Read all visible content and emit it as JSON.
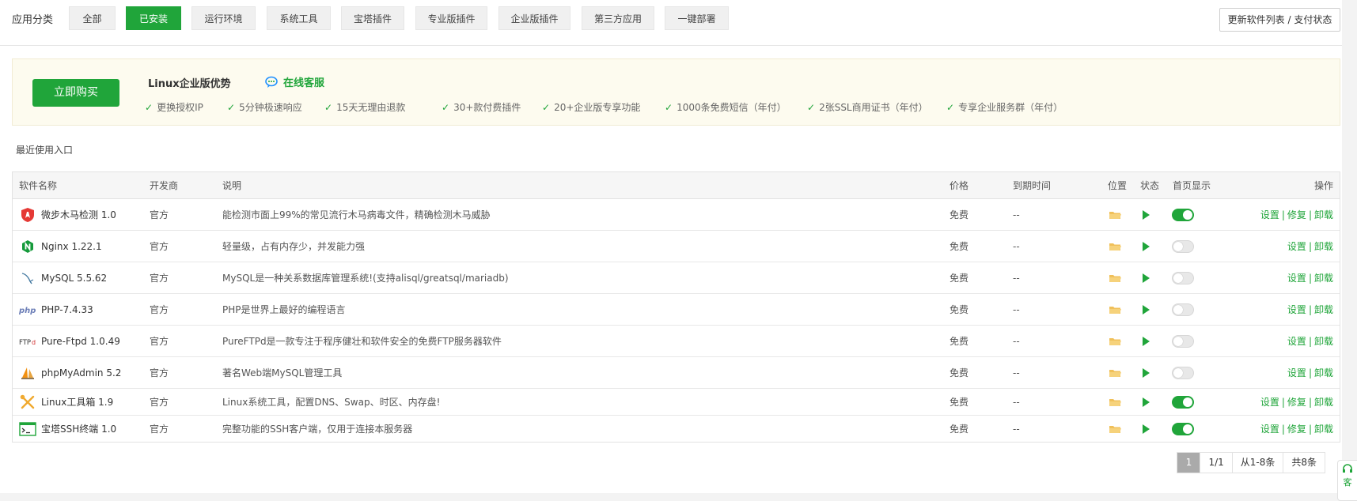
{
  "category": {
    "label": "应用分类",
    "tabs": [
      "全部",
      "已安装",
      "运行环境",
      "系统工具",
      "宝塔插件",
      "专业版插件",
      "企业版插件",
      "第三方应用",
      "一键部署"
    ],
    "active_index": 1,
    "update_button": "更新软件列表 / 支付状态"
  },
  "promo": {
    "buy_button": "立即购买",
    "title": "Linux企业版优势",
    "service_link": "在线客服",
    "features": [
      "更换授权IP",
      "5分钟极速响应",
      "15天无理由退款",
      "30+款付费插件",
      "20+企业版专享功能",
      "1000条免费短信（年付）",
      "2张SSL商用证书（年付）",
      "专享企业服务群（年付）"
    ]
  },
  "recent_label": "最近使用入口",
  "table": {
    "headers": {
      "name": "软件名称",
      "developer": "开发商",
      "description": "说明",
      "price": "价格",
      "expire": "到期时间",
      "location": "位置",
      "status": "状态",
      "homepage": "首页显示",
      "ops": "操作"
    },
    "rows": [
      {
        "icon": "shield-horse-icon",
        "name": "微步木马检测 1.0",
        "developer": "官方",
        "description": "能检测市面上99%的常见流行木马病毒文件，精确检测木马威胁",
        "price": "免费",
        "expire": "--",
        "homepage_on": true,
        "ops": [
          "设置",
          "修复",
          "卸载"
        ]
      },
      {
        "icon": "nginx-icon",
        "name": "Nginx 1.22.1",
        "developer": "官方",
        "description": "轻量级，占有内存少，并发能力强",
        "price": "免费",
        "expire": "--",
        "homepage_on": false,
        "ops": [
          "设置",
          "卸载"
        ]
      },
      {
        "icon": "mysql-icon",
        "name": "MySQL 5.5.62",
        "developer": "官方",
        "description": "MySQL是一种关系数据库管理系统!(支持alisql/greatsql/mariadb)",
        "price": "免费",
        "expire": "--",
        "homepage_on": false,
        "ops": [
          "设置",
          "卸载"
        ]
      },
      {
        "icon": "php-icon",
        "name": "PHP-7.4.33",
        "developer": "官方",
        "description": "PHP是世界上最好的编程语言",
        "price": "免费",
        "expire": "--",
        "homepage_on": false,
        "ops": [
          "设置",
          "卸载"
        ]
      },
      {
        "icon": "ftp-icon",
        "name": "Pure-Ftpd 1.0.49",
        "developer": "官方",
        "description": "PureFTPd是一款专注于程序健壮和软件安全的免费FTP服务器软件",
        "price": "免费",
        "expire": "--",
        "homepage_on": false,
        "ops": [
          "设置",
          "卸载"
        ]
      },
      {
        "icon": "phpmyadmin-icon",
        "name": "phpMyAdmin 5.2",
        "developer": "官方",
        "description": "著名Web端MySQL管理工具",
        "price": "免费",
        "expire": "--",
        "homepage_on": false,
        "ops": [
          "设置",
          "卸载"
        ]
      },
      {
        "icon": "toolbox-icon",
        "name": "Linux工具箱 1.9",
        "developer": "官方",
        "description": "Linux系统工具，配置DNS、Swap、时区、内存盘!",
        "price": "免费",
        "expire": "--",
        "homepage_on": true,
        "ops": [
          "设置",
          "修复",
          "卸载"
        ]
      },
      {
        "icon": "terminal-icon",
        "name": "宝塔SSH终端 1.0",
        "developer": "官方",
        "description": "完整功能的SSH客户端，仅用于连接本服务器",
        "price": "免费",
        "expire": "--",
        "homepage_on": true,
        "ops": [
          "设置",
          "修复",
          "卸载"
        ]
      }
    ]
  },
  "pagination": {
    "current": "1",
    "pages": "1/1",
    "range": "从1-8条",
    "total": "共8条"
  },
  "float_service": "客",
  "colors": {
    "accent": "#20a53a",
    "promo_bg": "#fdfbef",
    "folder": "#f0c05a"
  }
}
